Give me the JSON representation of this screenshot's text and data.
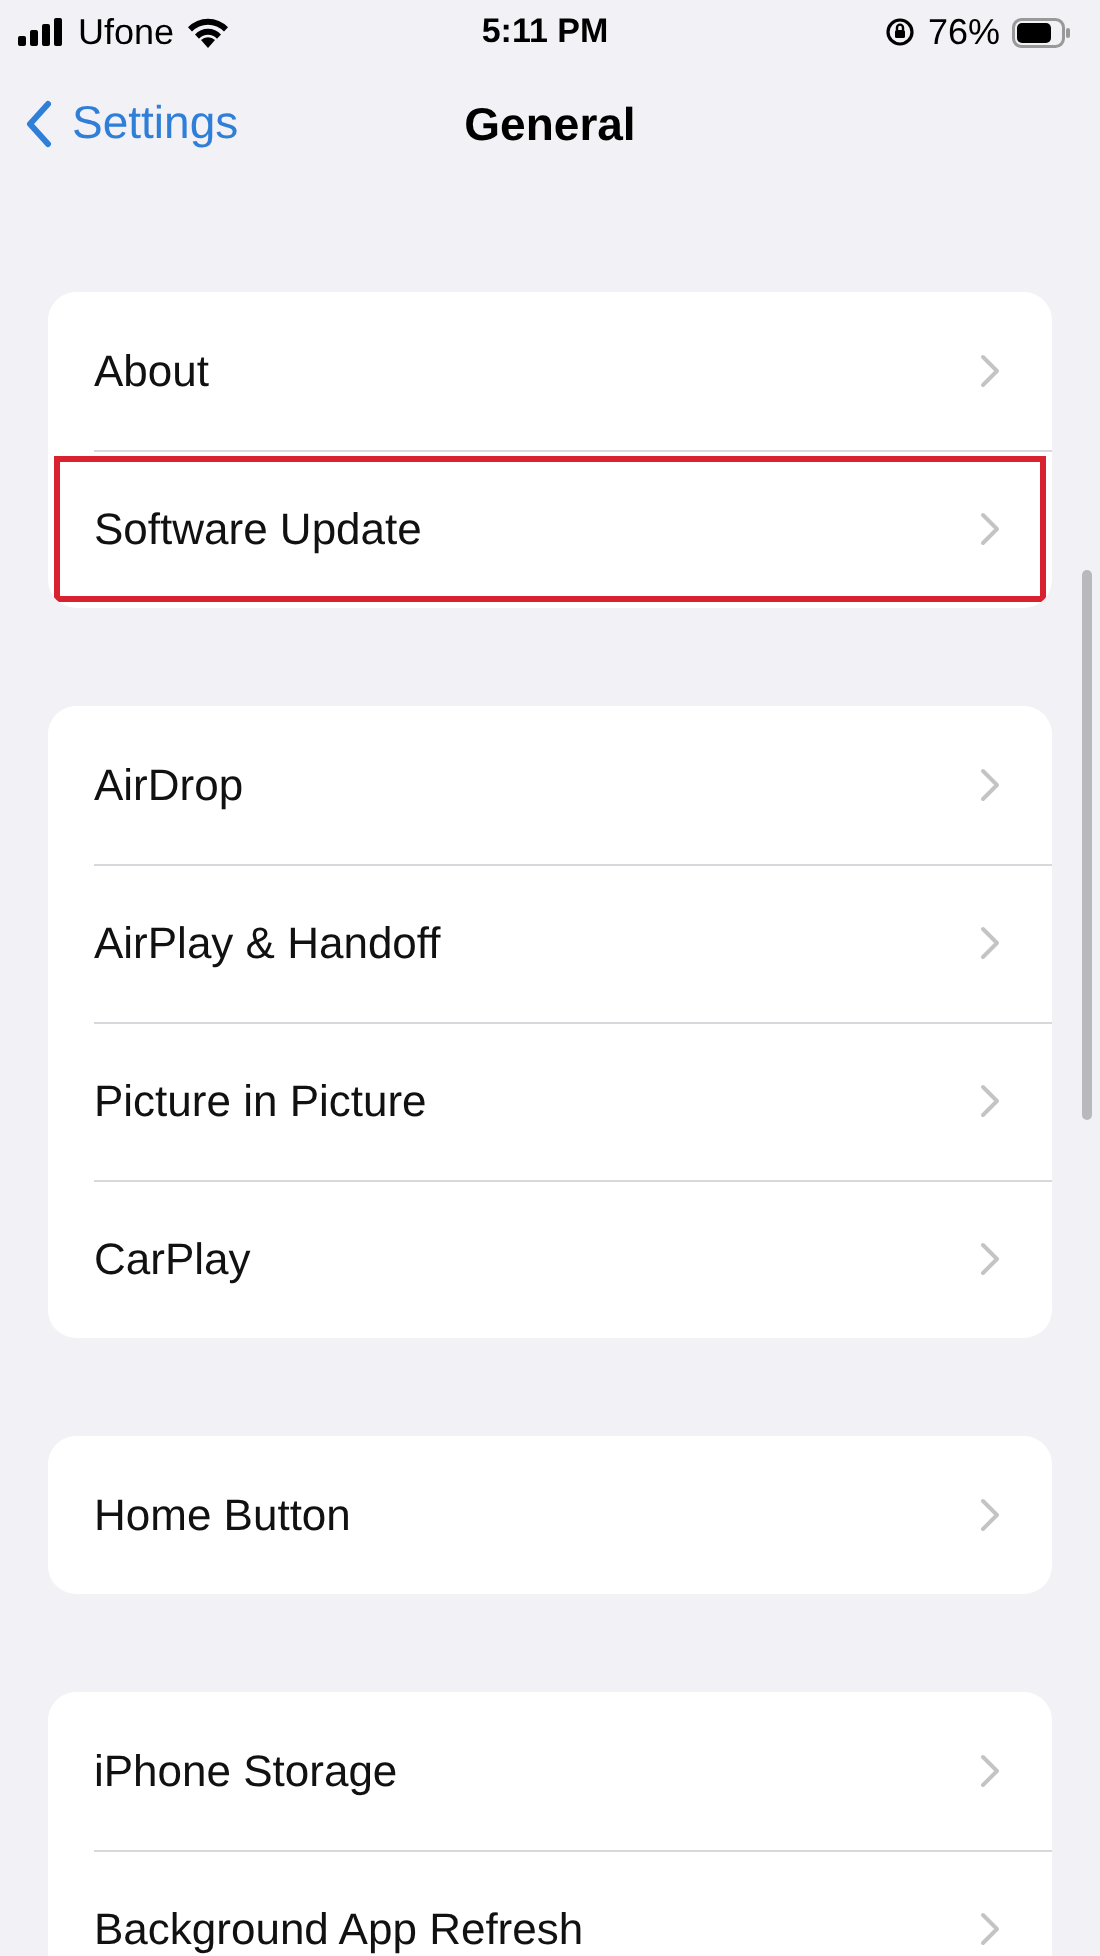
{
  "status_bar": {
    "carrier": "Ufone",
    "time": "5:11 PM",
    "battery": "76%"
  },
  "nav": {
    "back": "Settings",
    "title": "General"
  },
  "groups": [
    {
      "items": [
        {
          "label": "About",
          "highlighted": false
        },
        {
          "label": "Software Update",
          "highlighted": true
        }
      ]
    },
    {
      "items": [
        {
          "label": "AirDrop",
          "highlighted": false
        },
        {
          "label": "AirPlay & Handoff",
          "highlighted": false
        },
        {
          "label": "Picture in Picture",
          "highlighted": false
        },
        {
          "label": "CarPlay",
          "highlighted": false
        }
      ]
    },
    {
      "items": [
        {
          "label": "Home Button",
          "highlighted": false
        }
      ]
    },
    {
      "items": [
        {
          "label": "iPhone Storage",
          "highlighted": false
        },
        {
          "label": "Background App Refresh",
          "highlighted": false
        }
      ]
    }
  ]
}
